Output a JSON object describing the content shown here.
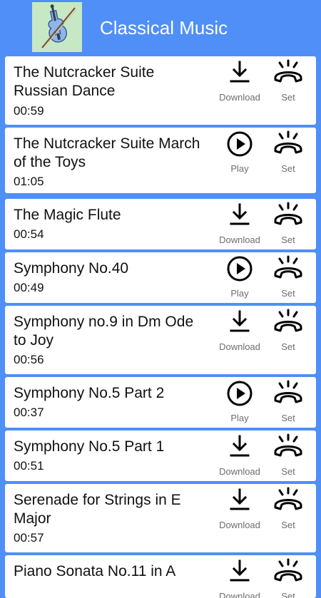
{
  "app": {
    "title": "Classical Music",
    "logo_icon": "violin-icon"
  },
  "colors": {
    "background": "#4f8ff7",
    "card": "#ffffff",
    "label": "#6e6e6e",
    "logo_bg": "#c7e8c4"
  },
  "tracks": [
    {
      "title": "The Nutcracker Suite Russian Dance",
      "duration": "00:59",
      "action": "Download",
      "action_icon": "download-icon",
      "set_label": "Set",
      "set_icon": "ringtone-phone-icon"
    },
    {
      "title": "The Nutcracker Suite March of the Toys",
      "duration": "01:05",
      "action": "Play",
      "action_icon": "play-icon",
      "set_label": "Set",
      "set_icon": "ringtone-phone-icon"
    },
    {
      "title": "The Magic Flute",
      "duration": "00:54",
      "action": "Download",
      "action_icon": "download-icon",
      "set_label": "Set",
      "set_icon": "ringtone-phone-icon"
    },
    {
      "title": "Symphony No.40",
      "duration": "00:49",
      "action": "Play",
      "action_icon": "play-icon",
      "set_label": "Set",
      "set_icon": "ringtone-phone-icon"
    },
    {
      "title": "Symphony no.9 in Dm Ode to Joy",
      "duration": "00:56",
      "action": "Download",
      "action_icon": "download-icon",
      "set_label": "Set",
      "set_icon": "ringtone-phone-icon"
    },
    {
      "title": "Symphony No.5 Part 2",
      "duration": "00:37",
      "action": "Play",
      "action_icon": "play-icon",
      "set_label": "Set",
      "set_icon": "ringtone-phone-icon"
    },
    {
      "title": "Symphony No.5 Part 1",
      "duration": "00:51",
      "action": "Download",
      "action_icon": "download-icon",
      "set_label": "Set",
      "set_icon": "ringtone-phone-icon"
    },
    {
      "title": "Serenade for Strings in E Major",
      "duration": "00:57",
      "action": "Download",
      "action_icon": "download-icon",
      "set_label": "Set",
      "set_icon": "ringtone-phone-icon"
    },
    {
      "title": "Piano Sonata No.11 in A",
      "duration": "",
      "action": "Download",
      "action_icon": "download-icon",
      "set_label": "Set",
      "set_icon": "ringtone-phone-icon"
    }
  ]
}
